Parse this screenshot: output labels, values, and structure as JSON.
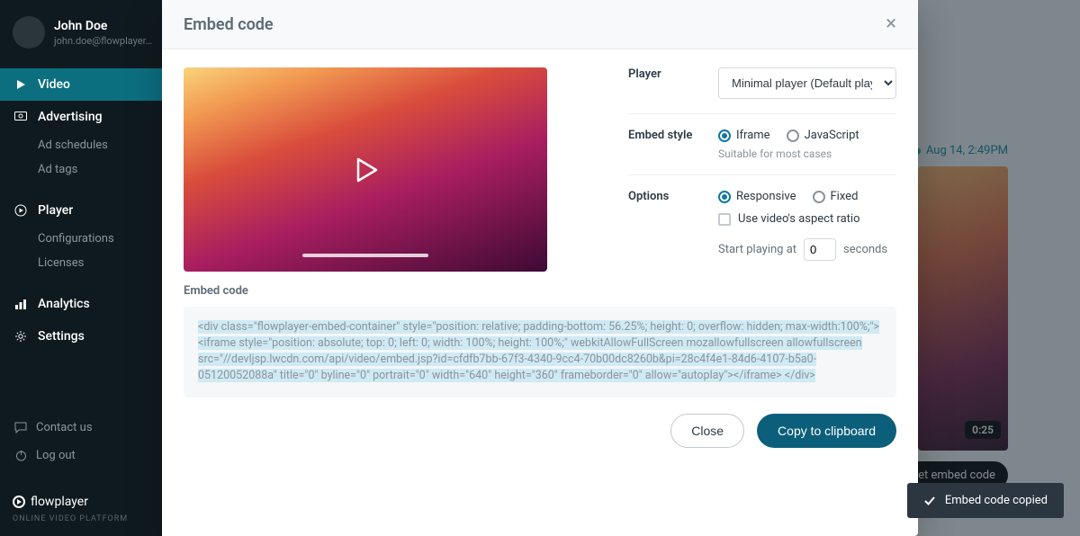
{
  "user": {
    "name": "John Doe",
    "email": "john.doe@flowplayer…"
  },
  "nav": {
    "video": "Video",
    "advertising": "Advertising",
    "ad_schedules": "Ad schedules",
    "ad_tags": "Ad tags",
    "player": "Player",
    "configurations": "Configurations",
    "licenses": "Licenses",
    "analytics": "Analytics",
    "settings": "Settings",
    "contact": "Contact us",
    "logout": "Log out"
  },
  "brand": {
    "name": "flowplayer",
    "tagline": "ONLINE VIDEO PLATFORM"
  },
  "bg": {
    "timestamp": "Aug 14, 2:49PM",
    "duration": "0:25",
    "get_embed": "Get embed code"
  },
  "modal": {
    "title": "Embed code",
    "player_label": "Player",
    "player_value": "Minimal player (Default player)",
    "embed_style_label": "Embed style",
    "style_iframe": "Iframe",
    "style_js": "JavaScript",
    "style_hint": "Suitable for most cases",
    "options_label": "Options",
    "opt_responsive": "Responsive",
    "opt_fixed": "Fixed",
    "opt_aspect": "Use video's aspect ratio",
    "start_pre": "Start playing at",
    "start_value": "0",
    "start_post": "seconds",
    "embed_code_label": "Embed code",
    "embed_code": "<div class=\"flowplayer-embed-container\" style=\"position: relative; padding-bottom: 56.25%; height: 0; overflow: hidden; max-width:100%;\"> <iframe style=\"position: absolute; top: 0; left: 0; width: 100%; height: 100%;\" webkitAllowFullScreen mozallowfullscreen allowfullscreen src=\"//devljsp.lwcdn.com/api/video/embed.jsp?id=cfdfb7bb-67f3-4340-9cc4-70b00dc8260b&pi=28c4f4e1-84d6-4107-b5a0-05120052088a\" title=\"0\" byline=\"0\" portrait=\"0\" width=\"640\" height=\"360\" frameborder=\"0\" allow=\"autoplay\"></iframe> </div>",
    "close_btn": "Close",
    "copy_btn": "Copy to clipboard"
  },
  "toast": {
    "text": "Embed code copied"
  }
}
